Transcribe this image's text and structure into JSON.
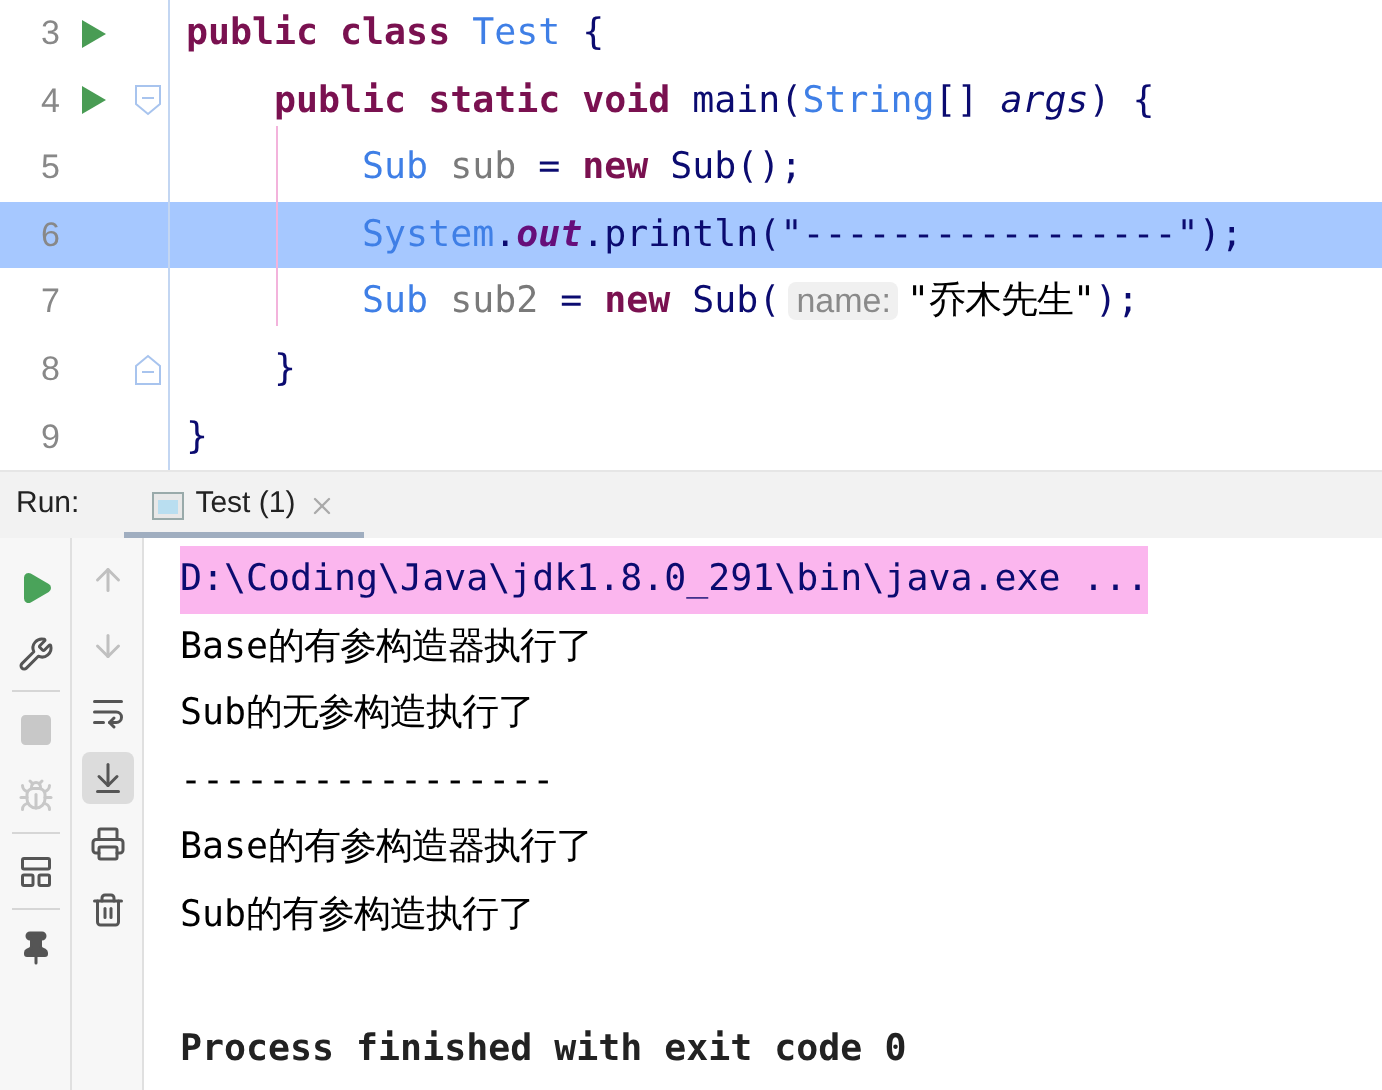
{
  "editor": {
    "lines": [
      {
        "number": "3",
        "runnable": true,
        "fold_start": false,
        "fold_end": false,
        "selected": false,
        "tokens": [
          {
            "kind": "keyword",
            "text": "public class "
          },
          {
            "kind": "type",
            "text": "Test"
          },
          {
            "kind": "plain",
            "text": " {"
          }
        ]
      },
      {
        "number": "4",
        "runnable": true,
        "fold_start": true,
        "fold_end": false,
        "selected": false,
        "tokens": [
          {
            "kind": "keyword",
            "text": "    public static void "
          },
          {
            "kind": "plain",
            "text": "main("
          },
          {
            "kind": "type",
            "text": "String"
          },
          {
            "kind": "plain",
            "text": "[] "
          },
          {
            "kind": "param",
            "text": "args"
          },
          {
            "kind": "plain",
            "text": ") {"
          }
        ]
      },
      {
        "number": "5",
        "runnable": false,
        "fold_start": false,
        "fold_end": false,
        "selected": false,
        "tokens": [
          {
            "kind": "type",
            "text": "        Sub"
          },
          {
            "kind": "variable",
            "text": " sub "
          },
          {
            "kind": "plain",
            "text": "= "
          },
          {
            "kind": "keyword",
            "text": "new "
          },
          {
            "kind": "plain",
            "text": "Sub();"
          }
        ]
      },
      {
        "number": "6",
        "runnable": false,
        "fold_start": false,
        "fold_end": false,
        "selected": true,
        "tokens": [
          {
            "kind": "type",
            "text": "        System"
          },
          {
            "kind": "plain",
            "text": "."
          },
          {
            "kind": "static",
            "text": "out"
          },
          {
            "kind": "plain",
            "text": ".println(\"-----------------\");"
          }
        ]
      },
      {
        "number": "7",
        "runnable": false,
        "fold_start": false,
        "fold_end": false,
        "selected": false,
        "tokens": [
          {
            "kind": "type",
            "text": "        Sub"
          },
          {
            "kind": "variable",
            "text": " sub2 "
          },
          {
            "kind": "plain",
            "text": "= "
          },
          {
            "kind": "keyword",
            "text": "new "
          },
          {
            "kind": "plain",
            "text": "Sub("
          },
          {
            "kind": "hint",
            "text": "name:"
          },
          {
            "kind": "string",
            "text": "\"乔木先生\""
          },
          {
            "kind": "plain",
            "text": ");"
          }
        ]
      },
      {
        "number": "8",
        "runnable": false,
        "fold_start": false,
        "fold_end": true,
        "selected": false,
        "tokens": [
          {
            "kind": "plain",
            "text": "    }"
          }
        ]
      },
      {
        "number": "9",
        "runnable": false,
        "fold_start": false,
        "fold_end": false,
        "selected": false,
        "tokens": [
          {
            "kind": "plain",
            "text": "}"
          }
        ]
      }
    ]
  },
  "run_panel": {
    "label": "Run:",
    "tabs": [
      {
        "title": "Test (1)",
        "selected": true
      }
    ],
    "left_toolbar": [
      {
        "disabled": false
      },
      {
        "disabled": false
      },
      {
        "disabled": true
      },
      {
        "disabled": true
      },
      {
        "disabled": false
      },
      {
        "disabled": false
      }
    ],
    "right_toolbar": [
      {
        "disabled": true,
        "toggled": false
      },
      {
        "disabled": true,
        "toggled": false
      },
      {
        "disabled": false,
        "toggled": false
      },
      {
        "disabled": false,
        "toggled": true
      },
      {
        "disabled": false,
        "toggled": false
      },
      {
        "disabled": false,
        "toggled": false
      }
    ],
    "console": [
      {
        "kind": "command",
        "text": "D:\\Coding\\Java\\jdk1.8.0_291\\bin\\java.exe ..."
      },
      {
        "kind": "output",
        "text": "Base的有参构造器执行了"
      },
      {
        "kind": "output",
        "text": "Sub的无参构造执行了"
      },
      {
        "kind": "output",
        "text": "-----------------"
      },
      {
        "kind": "output",
        "text": "Base的有参构造器执行了"
      },
      {
        "kind": "output",
        "text": "Sub的有参构造执行了"
      },
      {
        "kind": "blank"
      },
      {
        "kind": "status",
        "text": "Process finished with exit code 0"
      }
    ]
  }
}
